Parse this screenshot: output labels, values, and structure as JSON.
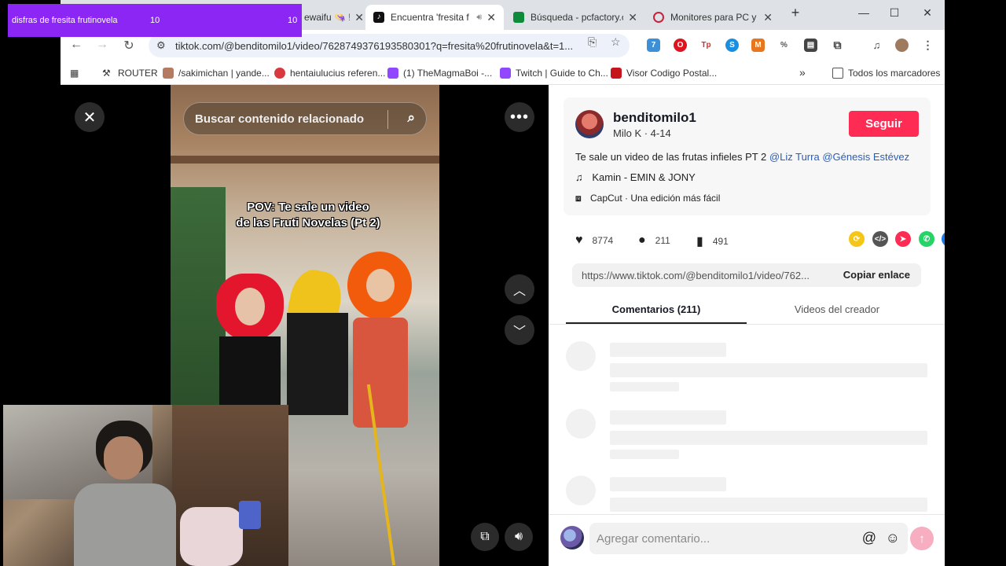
{
  "overlay": {
    "label": "disfras de fresita frutinovela",
    "count_left": "10",
    "count_right": "10"
  },
  "tabs": [
    {
      "title": "ewaifu 👒 !",
      "active": false
    },
    {
      "title": "Encuentra 'fresita f",
      "active": true
    },
    {
      "title": "Búsqueda - pcfactory.c",
      "active": false
    },
    {
      "title": "Monitores para PC y G",
      "active": false
    }
  ],
  "address": {
    "url": "tiktok.com/@benditomilo1/video/7628749376193580301?q=fresita%20frutinovela&t=1..."
  },
  "bookmarks": [
    {
      "label": "ROUTER"
    },
    {
      "label": "/sakimichan | yande..."
    },
    {
      "label": "hentaiulucius referen..."
    },
    {
      "label": "(1) TheMagmaBoi -..."
    },
    {
      "label": "Twitch | Guide to Ch..."
    },
    {
      "label": "Visor Codigo Postal..."
    }
  ],
  "bookmarks_all": "Todos los marcadores",
  "video": {
    "search_placeholder": "Buscar contenido relacionado",
    "caption_line1": "POV: Te sale un video",
    "caption_line2": "de las Fruti Novelas (Pt 2)"
  },
  "creator": {
    "username": "benditomilo1",
    "subtitle": "Milo K · 4-14",
    "follow_label": "Seguir",
    "description": "Te sale un video de las frutas infieles PT 2",
    "mentions": [
      "@Liz Turra",
      "@Génesis Estévez"
    ],
    "music": "Kamin - EMIN & JONY",
    "capcut": "CapCut · Una edición más fácil"
  },
  "stats": {
    "likes": "8774",
    "comments": "211",
    "saves": "491"
  },
  "link": {
    "url": "https://www.tiktok.com/@benditomilo1/video/762...",
    "copy_label": "Copiar enlace"
  },
  "panel_tabs": {
    "comments": "Comentarios (211)",
    "creator_videos": "Videos del creador"
  },
  "comment_box": {
    "placeholder": "Agregar comentario..."
  },
  "colors": {
    "accent": "#fe2c55",
    "mention": "#2b5db8",
    "overlay": "#8b26f5"
  }
}
